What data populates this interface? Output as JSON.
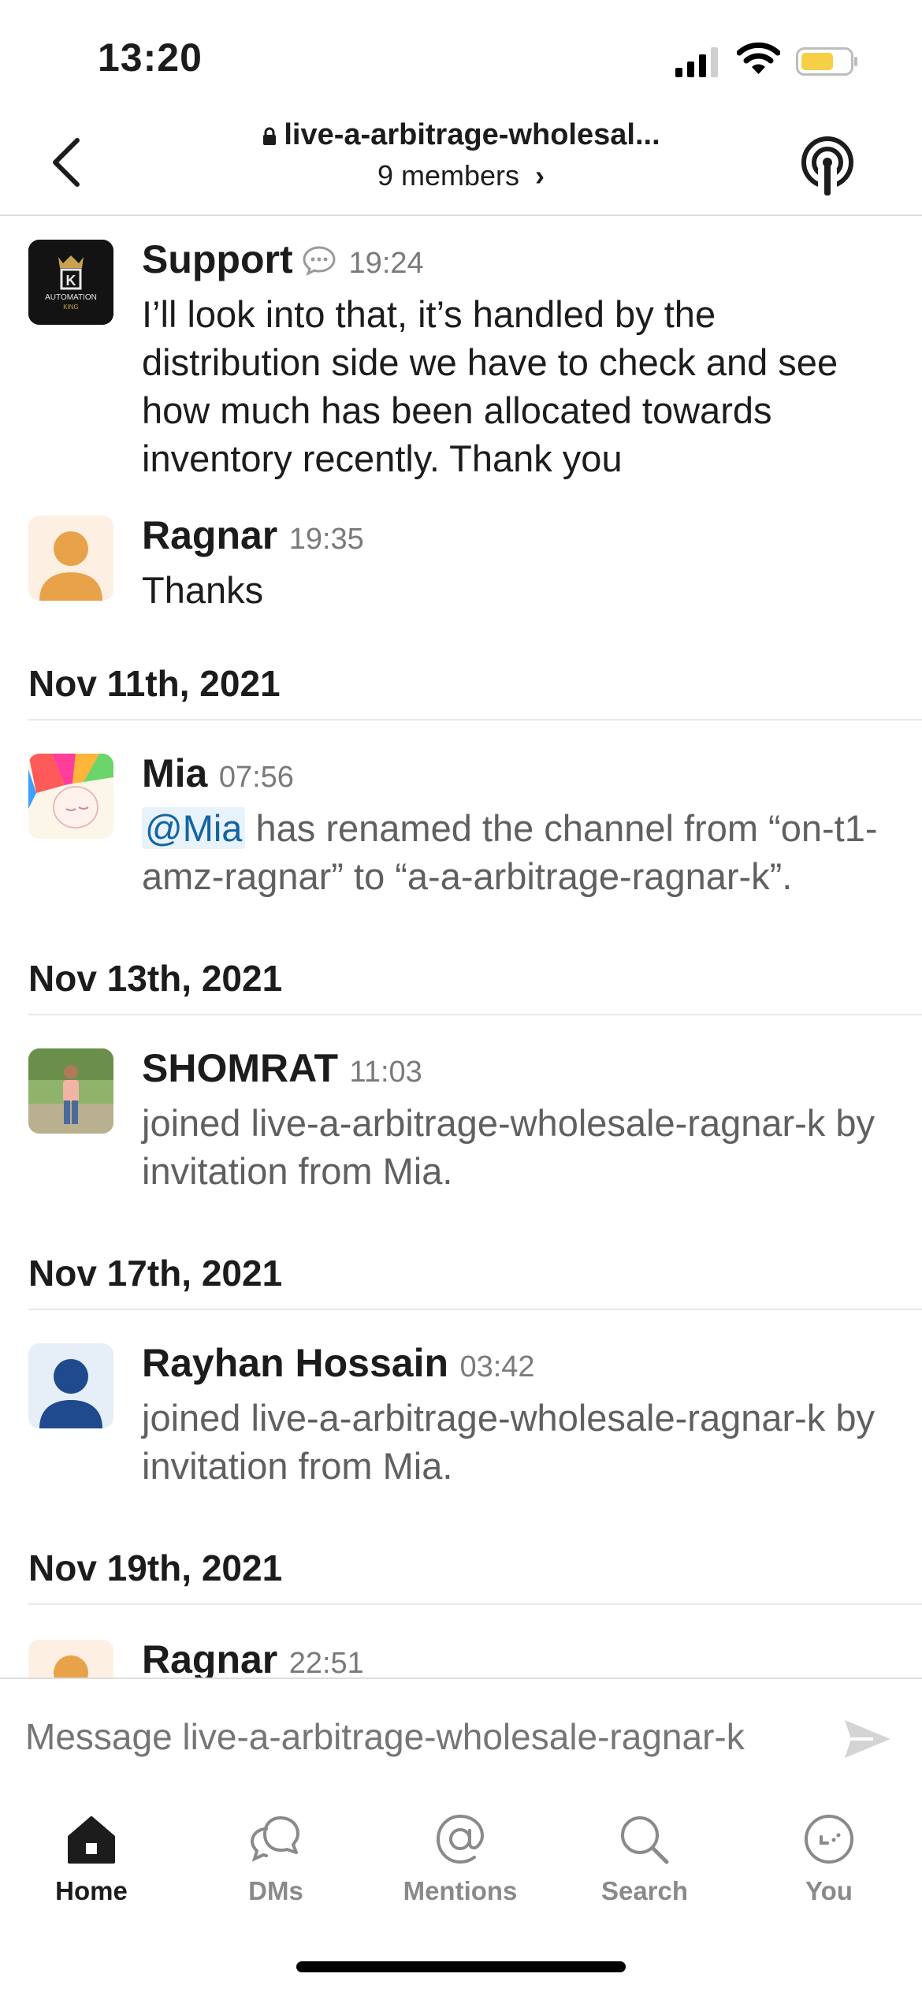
{
  "status_bar": {
    "time": "13:20"
  },
  "header": {
    "channel_name": "live-a-arbitrage-wholesal...",
    "members": "9 members",
    "members_chevron": "›"
  },
  "messages": [
    {
      "name": "Support",
      "time": "19:24",
      "text": "I’ll look into that, it’s handled by the distribution side we have to check and see how much has been allocated towards inventory recently. Thank you",
      "avatar_text": "AUTOMATION KING"
    },
    {
      "name": "Ragnar",
      "time": "19:35",
      "text": "Thanks"
    },
    {
      "date": "Nov 11th, 2021"
    },
    {
      "name": "Mia",
      "time": "07:56",
      "mention": "@Mia",
      "text": " has renamed the channel from “on-t1-amz-ragnar” to “a-a-arbitrage-ragnar-k”."
    },
    {
      "date": "Nov 13th, 2021"
    },
    {
      "name": "SHOMRAT",
      "time": "11:03",
      "text": "joined live-a-arbitrage-wholesale-ragnar-k by invitation from Mia."
    },
    {
      "date": "Nov 17th, 2021"
    },
    {
      "name": "Rayhan Hossain",
      "time": "03:42",
      "text": "joined live-a-arbitrage-wholesale-ragnar-k by invitation from Mia."
    },
    {
      "date": "Nov 19th, 2021"
    },
    {
      "name": "Ragnar",
      "time": "22:51"
    }
  ],
  "composer": {
    "placeholder": "Message live-a-arbitrage-wholesale-ragnar-k"
  },
  "tabs": [
    {
      "label": "Home",
      "icon": "home-icon",
      "active": true
    },
    {
      "label": "DMs",
      "icon": "dms-icon"
    },
    {
      "label": "Mentions",
      "icon": "mentions-icon"
    },
    {
      "label": "Search",
      "icon": "search-icon"
    },
    {
      "label": "You",
      "icon": "you-icon"
    }
  ],
  "colors": {
    "mention_bg": "#e8f2fa",
    "mention_text": "#1264a3",
    "battery": "#f7cf46",
    "avatar_blue": "#1f4b8e",
    "avatar_orange": "#e8a24a"
  }
}
